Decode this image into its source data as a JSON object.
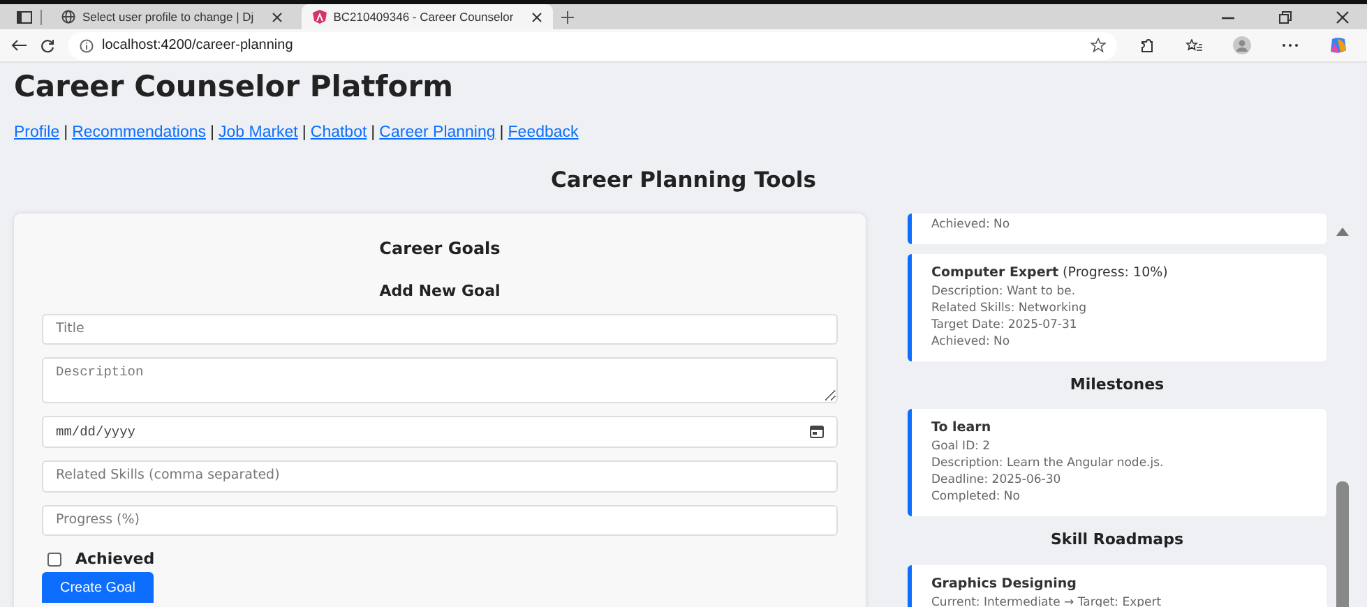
{
  "browser": {
    "tabs": [
      {
        "title": "Select user profile to change | Dj",
        "kind": "globe",
        "selected": false
      },
      {
        "title": "BC210409346 - Career Counselor",
        "kind": "shield",
        "selected": true
      }
    ],
    "address": "localhost:4200/career-planning"
  },
  "page": {
    "title": "Career Counselor Platform",
    "nav": [
      "Profile",
      "Recommendations",
      "Job Market",
      "Chatbot",
      "Career Planning",
      "Feedback"
    ],
    "nav_separator": "|",
    "section_title": "Career Planning Tools"
  },
  "goal_form": {
    "heading": "Career Goals",
    "subheading": "Add New Goal",
    "fields": [
      {
        "kind": "text",
        "placeholder": "Title"
      },
      {
        "kind": "textarea",
        "placeholder": "Description"
      },
      {
        "kind": "date",
        "value": "mm/dd/yyyy"
      },
      {
        "kind": "text",
        "placeholder": "Related Skills (comma separated)"
      },
      {
        "kind": "text",
        "placeholder": "Progress (%)"
      }
    ],
    "checkbox": {
      "label": "Achieved",
      "checked": false
    },
    "button": "Create Goal"
  },
  "goals": [
    {
      "lines": [
        "Achieved: No"
      ]
    },
    {
      "title": "**Computer Expert** (Progress: 10%)",
      "lines": [
        "Description: Want to be.",
        "Related Skills: Networking",
        "Target Date: 2025-07-31",
        "Achieved: No"
      ]
    }
  ],
  "milestones": {
    "heading": "Milestones",
    "items": [
      {
        "title": "To learn",
        "lines": [
          "Goal ID: 2",
          "Description: Learn the Angular node.js.",
          "Deadline: 2025-06-30",
          "Completed: No"
        ]
      }
    ]
  },
  "roadmaps": {
    "heading": "Skill Roadmaps",
    "items": [
      {
        "title": "Graphics Designing",
        "lines": [
          "Current: Intermediate → Target: Expert"
        ]
      }
    ]
  }
}
